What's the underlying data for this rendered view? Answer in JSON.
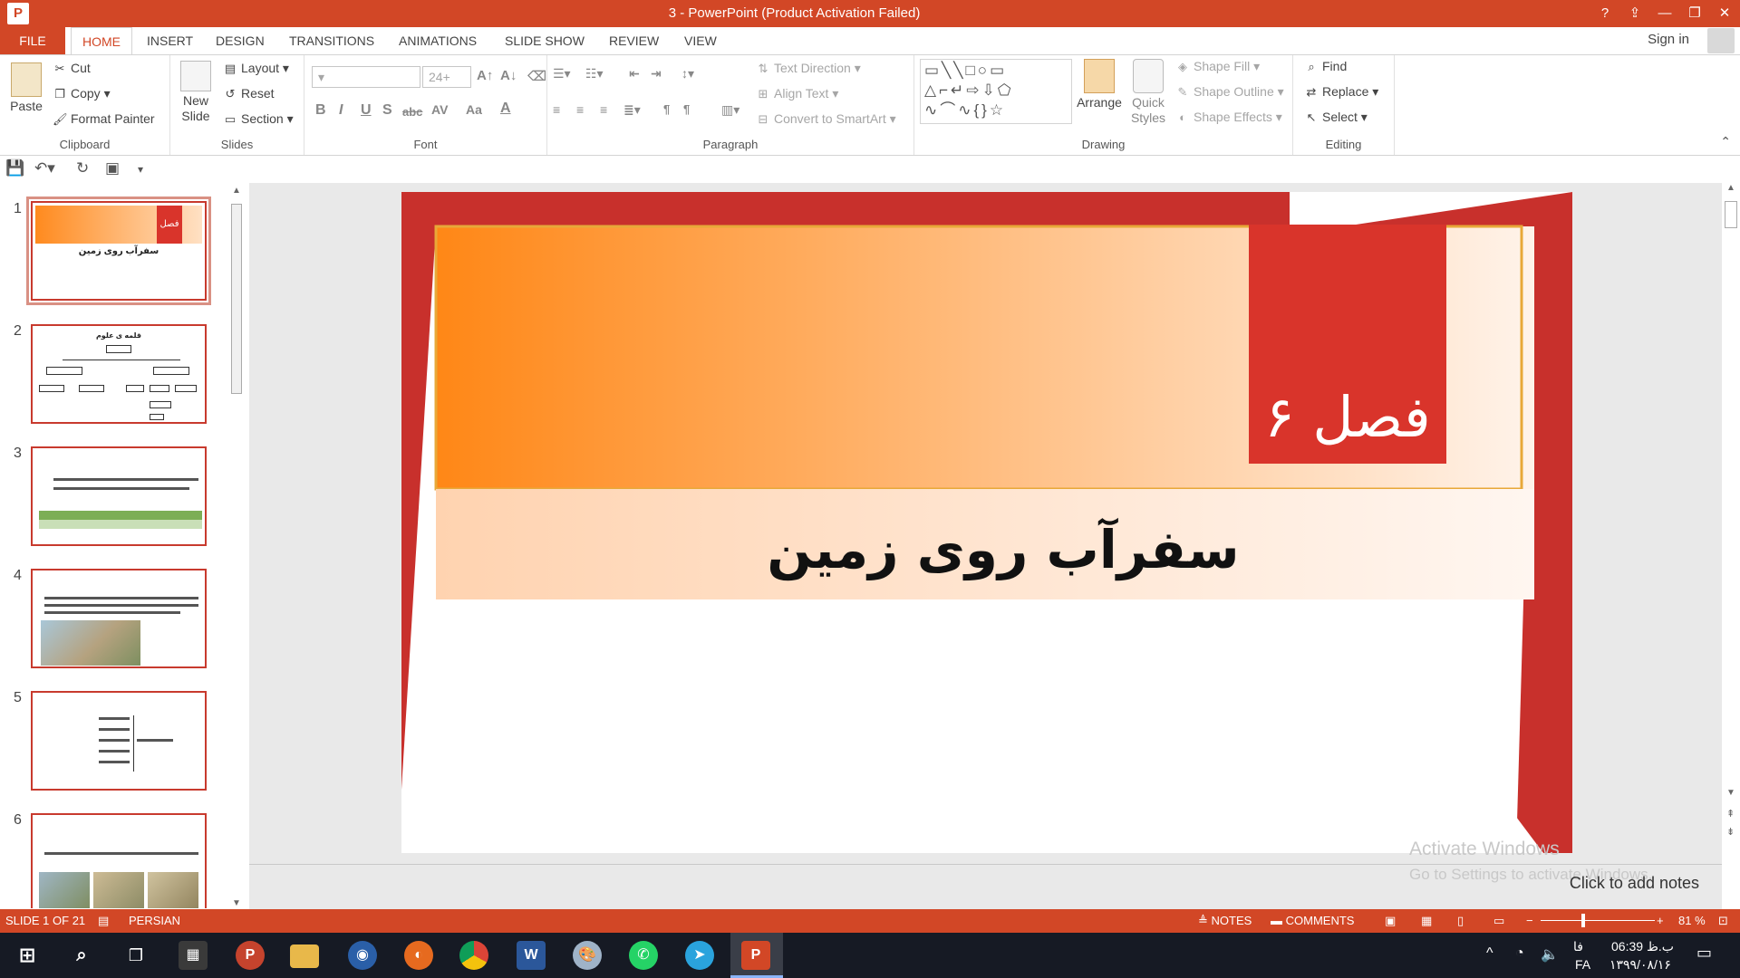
{
  "window": {
    "title": "3 -  PowerPoint (Product Activation Failed)",
    "help": "?",
    "ribbon_display": "⇪",
    "minimize": "—",
    "restore": "❐",
    "close": "✕"
  },
  "tabs": {
    "file": "FILE",
    "items": [
      "HOME",
      "INSERT",
      "DESIGN",
      "TRANSITIONS",
      "ANIMATIONS",
      "SLIDE SHOW",
      "REVIEW",
      "VIEW"
    ],
    "active": "HOME",
    "signin": "Sign in"
  },
  "ribbon": {
    "clipboard": {
      "label": "Clipboard",
      "paste": "Paste",
      "cut": "Cut",
      "copy": "Copy",
      "format_painter": "Format Painter"
    },
    "slides": {
      "label": "Slides",
      "new_slide": "New Slide",
      "layout": "Layout",
      "reset": "Reset",
      "section": "Section"
    },
    "font": {
      "label": "Font",
      "font_size": "24+",
      "bold": "B",
      "italic": "I",
      "underline": "U",
      "shadow": "S",
      "strike": "abc",
      "spacing": "AV",
      "case": "Aa",
      "color": "A"
    },
    "paragraph": {
      "label": "Paragraph",
      "text_direction": "Text Direction",
      "align_text": "Align Text",
      "convert_smartart": "Convert to SmartArt"
    },
    "drawing": {
      "label": "Drawing",
      "arrange": "Arrange",
      "quick_styles": "Quick Styles",
      "shape_fill": "Shape Fill",
      "shape_outline": "Shape Outline",
      "shape_effects": "Shape Effects"
    },
    "editing": {
      "label": "Editing",
      "find": "Find",
      "replace": "Replace",
      "select": "Select"
    }
  },
  "thumbnails": [
    {
      "number": "1",
      "title": "فصل ۶",
      "subtitle": "سفرآب روی زمین",
      "selected": true
    },
    {
      "number": "2",
      "title": "قلمه ی علوم",
      "selected": false
    },
    {
      "number": "3",
      "selected": false
    },
    {
      "number": "4",
      "selected": false
    },
    {
      "number": "5",
      "selected": false
    },
    {
      "number": "6",
      "selected": false
    }
  ],
  "slide": {
    "chapter": "فصل ۶",
    "title": "سفرآب روی زمین",
    "colors": {
      "red": "#c8302c",
      "orange": "#ff8716",
      "gold": "#e8a838"
    }
  },
  "watermark": {
    "line1": "Activate Windows",
    "line2": "Go to Settings to activate Windows."
  },
  "notes_placeholder": "Click to add notes",
  "status": {
    "slide_info": "SLIDE 1 OF 21",
    "language": "PERSIAN",
    "notes": "NOTES",
    "comments": "COMMENTS",
    "zoom": "81 %"
  },
  "taskbar": {
    "apps": [
      "start",
      "search",
      "task-view",
      "calculator",
      "app-p",
      "file-explorer",
      "app-blue",
      "firefox",
      "chrome",
      "word",
      "paint",
      "whatsapp",
      "telegram",
      "powerpoint"
    ],
    "time": "06:39 ب.ظ",
    "date": "۱۳۹۹/۰۸/۱۶",
    "lang_top": "فا",
    "lang_bottom": "FA"
  }
}
